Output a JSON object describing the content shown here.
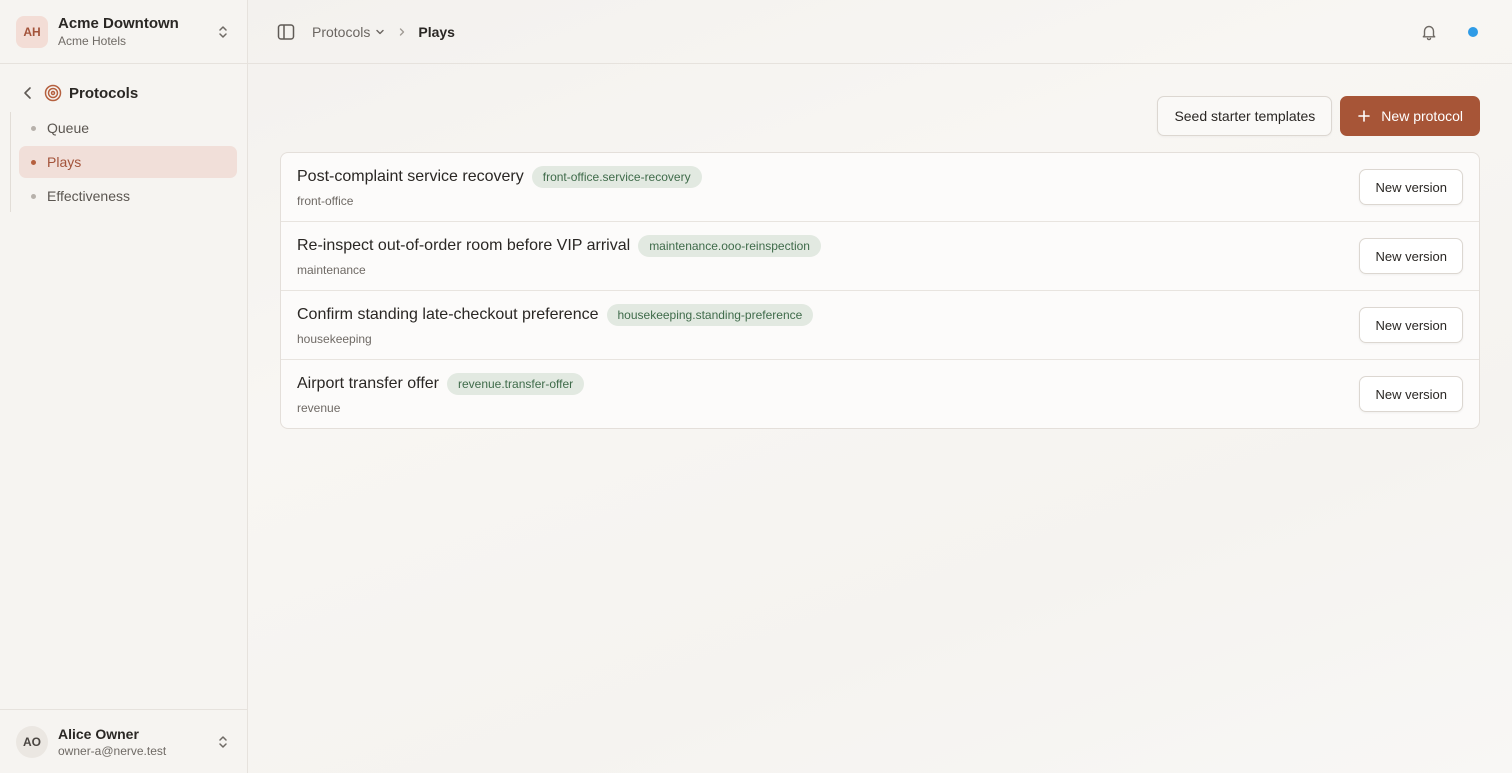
{
  "org": {
    "initials": "AH",
    "name": "Acme Downtown",
    "subtitle": "Acme Hotels"
  },
  "nav": {
    "section_title": "Protocols",
    "items": [
      {
        "label": "Queue",
        "active": false
      },
      {
        "label": "Plays",
        "active": true
      },
      {
        "label": "Effectiveness",
        "active": false
      }
    ]
  },
  "user": {
    "initials": "AO",
    "name": "Alice Owner",
    "email": "owner-a@nerve.test"
  },
  "breadcrumb": {
    "parent": "Protocols",
    "current": "Plays"
  },
  "actions": {
    "seed_label": "Seed starter templates",
    "new_label": "New protocol"
  },
  "protocols": [
    {
      "title": "Post-complaint service recovery",
      "key": "front-office.service-recovery",
      "department": "front-office",
      "button": "New version"
    },
    {
      "title": "Re-inspect out-of-order room before VIP arrival",
      "key": "maintenance.ooo-reinspection",
      "department": "maintenance",
      "button": "New version"
    },
    {
      "title": "Confirm standing late-checkout preference",
      "key": "housekeeping.standing-preference",
      "department": "housekeeping",
      "button": "New version"
    },
    {
      "title": "Airport transfer offer",
      "key": "revenue.transfer-offer",
      "department": "revenue",
      "button": "New version"
    }
  ],
  "colors": {
    "accent": "#a75537",
    "tag_bg": "#e2e9e1",
    "tag_text": "#3f6b4a",
    "status_dot": "#2f9be6"
  }
}
